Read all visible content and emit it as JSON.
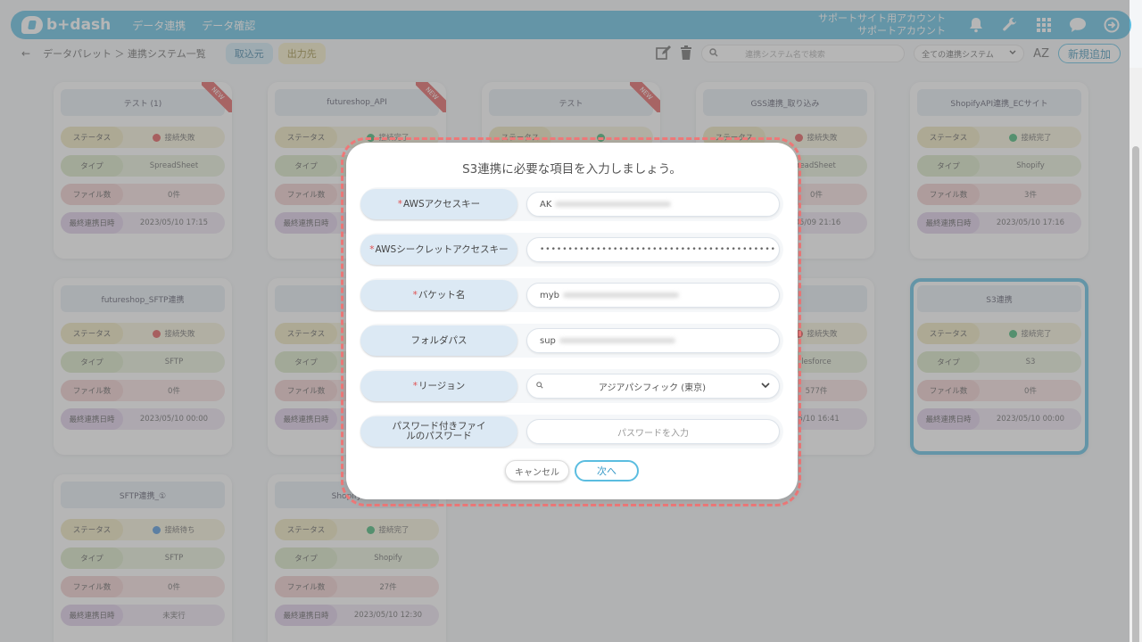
{
  "header": {
    "logo_text": "b+dash",
    "nav": [
      "データ連携",
      "データ確認"
    ],
    "account_line1": "サポートサイト用アカウント",
    "account_line2": "サポートアカウント"
  },
  "subbar": {
    "back": "←",
    "breadcrumb": "データパレット ＞ 連携システム一覧",
    "tab_in": "取込元",
    "tab_out": "出力先",
    "search_placeholder": "連携システム名で検索",
    "filter_value": "全ての連携システム",
    "sort_label": "AZ",
    "add_button": "新規追加"
  },
  "labels": {
    "status": "ステータス",
    "type": "タイプ",
    "files": "ファイル数",
    "date": "最終連携日時"
  },
  "cards": [
    {
      "title": "テスト (1)",
      "new": "NEW",
      "status": "接続失敗",
      "status_kind": "fail",
      "type": "SpreadSheet",
      "files": "0件",
      "date": "2023/05/10 17:15"
    },
    {
      "title": "futureshop_API",
      "new": "NEW",
      "status": "接続完了",
      "status_kind": "ok",
      "type": "",
      "files": "",
      "date": ""
    },
    {
      "title": "テスト",
      "new": "NEW",
      "status": "",
      "status_kind": "ok",
      "type": "",
      "files": "",
      "date": ""
    },
    {
      "title": "GSS連携_取り込み",
      "status": "接続失敗",
      "status_kind": "fail",
      "type": "readSheet",
      "files": "0件",
      "date": "/05/09 21:16"
    },
    {
      "title": "ShopifyAPI連携_ECサイト",
      "status": "接続完了",
      "status_kind": "ok",
      "type": "Shopify",
      "files": "3件",
      "date": "2023/05/10 17:16"
    },
    {
      "title": "futureshop_SFTP連携",
      "status": "接続失敗",
      "status_kind": "fail",
      "type": "SFTP",
      "files": "0件",
      "date": "2023/05/10 00:00"
    },
    {
      "title": "リ",
      "status": "",
      "status_kind": "ok",
      "type": "",
      "files": "",
      "date": ""
    },
    {
      "title": "",
      "status": "",
      "status_kind": "ok",
      "type": "",
      "files": "",
      "date": ""
    },
    {
      "title": "連携",
      "status": "接続失敗",
      "status_kind": "fail",
      "type": "lesforce",
      "files": "577件",
      "date": "05/10 16:41"
    },
    {
      "title": "S3連携",
      "status": "接続完了",
      "status_kind": "ok",
      "type": "S3",
      "files": "0件",
      "date": "2023/05/10 00:00"
    },
    {
      "title": "SFTP連携_①",
      "status": "接続待ち",
      "status_kind": "wait",
      "type": "SFTP",
      "files": "0件",
      "date": "未実行"
    },
    {
      "title": "ShopifyAPI連",
      "status": "接続完了",
      "status_kind": "ok",
      "type": "Shopify",
      "files": "27件",
      "date": "2023/05/10 12:30"
    }
  ],
  "modal": {
    "title": "S3連携に必要な項目を入力しましょう。",
    "fields": [
      {
        "label": "AWSアクセスキー",
        "required": true,
        "value": "AK"
      },
      {
        "label": "AWSシークレットアクセスキー",
        "required": true,
        "value": "••••••••••••••••••••••••••••••••••••••••••"
      },
      {
        "label": "バケット名",
        "required": true,
        "value": "myb"
      },
      {
        "label": "フォルダパス",
        "required": false,
        "value": "sup"
      },
      {
        "label": "リージョン",
        "required": true,
        "value": "アジアパシフィック (東京)"
      },
      {
        "label": "パスワード付きファイルのパスワード",
        "required": false,
        "placeholder": "パスワードを入力"
      }
    ],
    "cancel": "キャンセル",
    "next": "次へ",
    "required_mark": "*"
  }
}
